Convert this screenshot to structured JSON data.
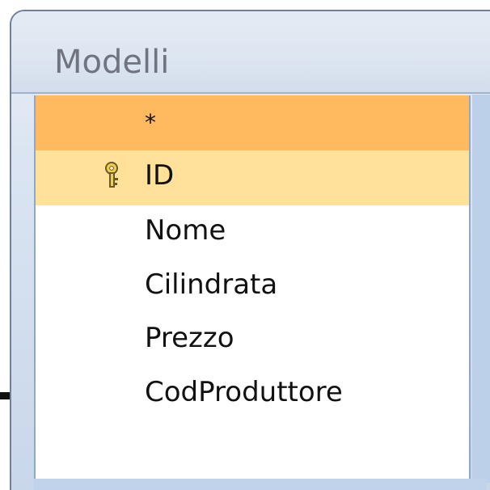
{
  "table": {
    "title": "Modelli",
    "fields": [
      {
        "label": "*",
        "icon": "",
        "selected": "all-fields"
      },
      {
        "label": "ID",
        "icon": "primary-key-icon",
        "selected": "primary-key"
      },
      {
        "label": "Nome",
        "icon": "",
        "selected": "none"
      },
      {
        "label": "Cilindrata",
        "icon": "",
        "selected": "none"
      },
      {
        "label": "Prezzo",
        "icon": "",
        "selected": "none"
      },
      {
        "label": "CodProduttore",
        "icon": "",
        "selected": "none"
      }
    ]
  },
  "colors": {
    "all_fields_row": "#ffb95f",
    "primary_key_row": "#ffe19a",
    "window_border": "#6f8199",
    "title_text": "#6f7480"
  }
}
